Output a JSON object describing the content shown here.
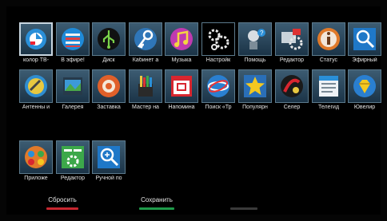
{
  "row1": [
    {
      "label": "колор ТВ-",
      "icon": "color-tv-icon"
    },
    {
      "label": "В эфире!",
      "icon": "on-air-icon"
    },
    {
      "label": "Диск",
      "icon": "disk-usb-icon"
    },
    {
      "label": "Кабинет а",
      "icon": "account-key-icon"
    },
    {
      "label": "Музыка",
      "icon": "music-icon"
    },
    {
      "label": "Настройк",
      "icon": "settings-gears-icon"
    },
    {
      "label": "Помощь",
      "icon": "help-robot-icon"
    },
    {
      "label": "Редактор",
      "icon": "editor-icon"
    },
    {
      "label": "Статус",
      "icon": "status-info-icon"
    },
    {
      "label": "Эфирный",
      "icon": "broadcast-search-icon"
    }
  ],
  "row2": [
    {
      "label": "Антенны и",
      "icon": "antenna-satellite-icon"
    },
    {
      "label": "Галерея",
      "icon": "gallery-icon"
    },
    {
      "label": "Заставка",
      "icon": "screensaver-icon"
    },
    {
      "label": "Мастер на",
      "icon": "setup-wizard-icon"
    },
    {
      "label": "Напомина",
      "icon": "reminder-calendar-icon"
    },
    {
      "label": "Поиск «Тр",
      "icon": "search-tricolor-icon"
    },
    {
      "label": "Популярн",
      "icon": "popular-star-icon"
    },
    {
      "label": "Селер",
      "icon": "seller-icon"
    },
    {
      "label": "Телегид",
      "icon": "tv-guide-icon"
    },
    {
      "label": "Ювелир",
      "icon": "jeweler-icon"
    }
  ],
  "row3": [
    {
      "label": "Приложе",
      "icon": "apps-icon"
    },
    {
      "label": "Редактор",
      "icon": "editor-settings-icon"
    },
    {
      "label": "Ручной по",
      "icon": "manual-search-icon"
    }
  ],
  "buttons": {
    "reset": {
      "label": "Сбросить",
      "color": "#c8262f"
    },
    "save": {
      "label": "Сохранить",
      "color": "#1f9a4a"
    },
    "third": {
      "label": "",
      "color": "#3a3a3a"
    }
  }
}
